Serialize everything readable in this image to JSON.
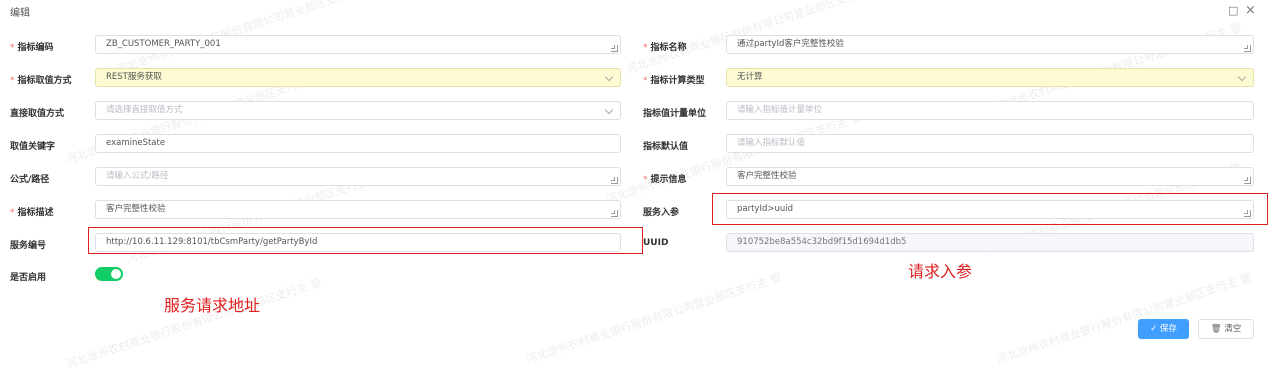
{
  "dialog": {
    "title": "编辑",
    "maximize_icon": "□",
    "close_icon": "×"
  },
  "left": {
    "code": {
      "label": "指标编码",
      "required": true,
      "value": "ZB_CUSTOMER_PARTY_001"
    },
    "value_method": {
      "label": "指标取值方式",
      "required": true,
      "value": "REST服务获取"
    },
    "direct_method": {
      "label": "直接取值方式",
      "required": false,
      "placeholder": "请选择直接取值方式"
    },
    "key_word": {
      "label": "取值关键字",
      "required": false,
      "value": "examineState"
    },
    "formula": {
      "label": "公式/路径",
      "required": false,
      "placeholder": "请输入公式/路径"
    },
    "description": {
      "label": "指标描述",
      "required": true,
      "value": "客户完整性校验"
    },
    "service_no": {
      "label": "服务编号",
      "required": false,
      "value": "http://10.6.11.129:8101/tbCsmParty/getPartyById"
    },
    "enabled": {
      "label": "是否启用",
      "on": true
    }
  },
  "right": {
    "name": {
      "label": "指标名称",
      "required": true,
      "value": "通过partyId客户完整性校验"
    },
    "calc_type": {
      "label": "指标计算类型",
      "required": true,
      "value": "无计算"
    },
    "unit": {
      "label": "指标值计量单位",
      "required": false,
      "placeholder": "请输入指标值计量单位"
    },
    "default": {
      "label": "指标默认值",
      "required": false,
      "placeholder": "请输入指标默认值"
    },
    "hint": {
      "label": "提示信息",
      "required": true,
      "value": "客户完整性校验"
    },
    "service_param": {
      "label": "服务入参",
      "required": false,
      "value": "partyId>uuid"
    },
    "uuid": {
      "label": "UUID",
      "required": false,
      "value": "910752be8a554c32bd9f15d1694d1db5"
    }
  },
  "annotations": {
    "service_addr": "服务请求地址",
    "request_param": "请求入参"
  },
  "buttons": {
    "save": "保存",
    "clear": "清空"
  },
  "watermark": "河北沧州农村商业银行股份有限公司营业部区支行主  管"
}
